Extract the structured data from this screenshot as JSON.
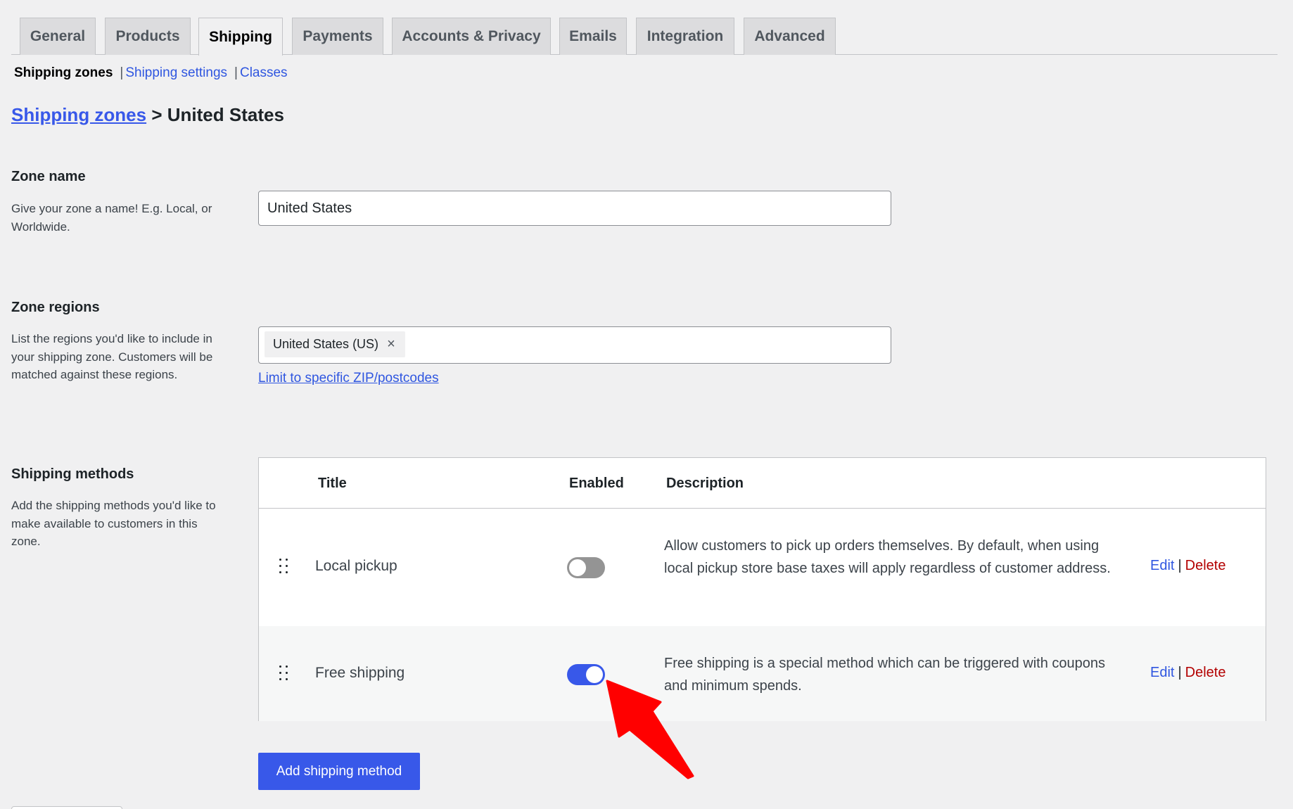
{
  "tabs": [
    {
      "label": "General",
      "active": false
    },
    {
      "label": "Products",
      "active": false
    },
    {
      "label": "Shipping",
      "active": true
    },
    {
      "label": "Payments",
      "active": false
    },
    {
      "label": "Accounts & Privacy",
      "active": false
    },
    {
      "label": "Emails",
      "active": false
    },
    {
      "label": "Integration",
      "active": false
    },
    {
      "label": "Advanced",
      "active": false
    }
  ],
  "subnav": {
    "current": "Shipping zones",
    "separator": "|",
    "links": [
      "Shipping settings",
      "Classes"
    ]
  },
  "breadcrumb": {
    "parent": "Shipping zones",
    "separator": ">",
    "current": "United States"
  },
  "zone_name": {
    "label": "Zone name",
    "description": "Give your zone a name! E.g. Local, or Worldwide.",
    "value": "United States"
  },
  "zone_regions": {
    "label": "Zone regions",
    "description": "List the regions you'd like to include in your shipping zone. Customers will be matched against these regions.",
    "chips": [
      {
        "label": "United States (US)",
        "remove_icon": "close-icon"
      }
    ],
    "limit_link": "Limit to specific ZIP/postcodes"
  },
  "shipping_methods": {
    "label": "Shipping methods",
    "description": "Add the shipping methods you'd like to make available to customers in this zone.",
    "columns": [
      "Title",
      "Enabled",
      "Description"
    ],
    "rows": [
      {
        "title": "Local pickup",
        "enabled": false,
        "description": "Allow customers to pick up orders themselves. By default, when using local pickup store base taxes will apply regardless of customer address.",
        "edit_label": "Edit",
        "delete_label": "Delete"
      },
      {
        "title": "Free shipping",
        "enabled": true,
        "description": "Free shipping is a special method which can be triggered with coupons and minimum spends.",
        "edit_label": "Edit",
        "delete_label": "Delete"
      }
    ],
    "add_button": "Add shipping method"
  },
  "colors": {
    "accent": "#3858e9",
    "link": "#2f56e0",
    "delete": "#b30000",
    "annotation_arrow": "#ff0000",
    "toggle_off": "#949494"
  },
  "annotation": {
    "icon": "arrow-pointer-icon",
    "target": "Free shipping enabled toggle"
  }
}
